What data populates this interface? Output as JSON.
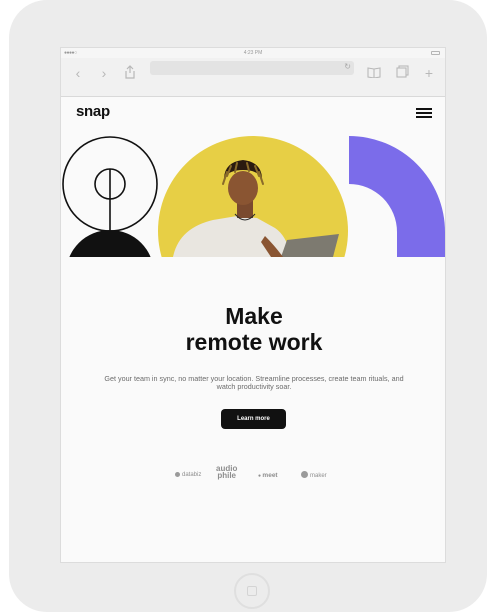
{
  "device": {
    "status_signal": "●●●●○",
    "time": "4:23 PM"
  },
  "browser": {
    "back_icon": "chevron-left-icon",
    "forward_icon": "chevron-right-icon",
    "share_icon": "share-icon",
    "reload_icon": "reload-icon",
    "bookmarks_icon": "book-icon",
    "tabs_icon": "tabs-icon",
    "new_tab_icon": "plus-icon"
  },
  "site": {
    "logo": "snap",
    "headline_line1": "Make",
    "headline_line2": "remote work",
    "description": "Get your team in sync, no matter your location. Streamline processes, create team rituals, and watch productivity soar.",
    "cta_label": "Learn more",
    "partners": {
      "databiz": "databiz",
      "audiophile_top": "audio",
      "audiophile_bottom": "phile",
      "meet": "meet",
      "maker": "maker"
    }
  },
  "colors": {
    "yellow": "#e7cf45",
    "purple": "#7b6cea",
    "ink": "#111111"
  }
}
